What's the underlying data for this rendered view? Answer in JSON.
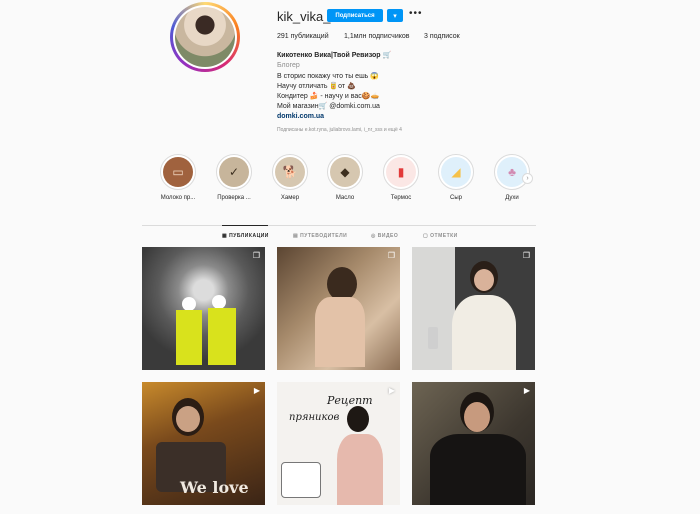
{
  "profile": {
    "username": "kik_vika_",
    "follow_label": "Подписаться",
    "dropdown_icon": "chevron-down-icon",
    "more_icon": "more-horizontal-icon",
    "stats": {
      "posts": "291 публикаций",
      "followers": "1,1млн подписчиков",
      "following": "3 подписок"
    },
    "bio": {
      "name": "Кикотенко Вика|Твой Ревизор 🛒",
      "category": "Блогер",
      "lines": [
        "В сторис покажу что ты ешь 😱",
        "Научу отличать 🥫от 💩",
        "Кондитер 🍰 - научу и вас🍪🥧",
        "Мой магазин🛒 @domki.com.ua"
      ],
      "link": "domki.com.ua",
      "followed_by": "Подписаны e.kot.ryna, juliabrovs.lami, i_nr_sss и ещё 4"
    }
  },
  "highlights": [
    {
      "label": "Молоко пр...",
      "icon": "milk-icon"
    },
    {
      "label": "Проверка ...",
      "icon": "check-icon"
    },
    {
      "label": "Хамер",
      "icon": "dog-icon"
    },
    {
      "label": "Масло",
      "icon": "butter-icon"
    },
    {
      "label": "Термос",
      "icon": "thermos-icon"
    },
    {
      "label": "Сыр",
      "icon": "cheese-icon"
    },
    {
      "label": "Духи",
      "icon": "perfume-icon"
    }
  ],
  "tabs": [
    {
      "label": "ПУБЛИКАЦИИ",
      "icon": "grid-icon",
      "active": true
    },
    {
      "label": "ПУТЕВОДИТЕЛИ",
      "icon": "guide-icon",
      "active": false
    },
    {
      "label": "ВИДЕО",
      "icon": "video-icon",
      "active": false
    },
    {
      "label": "ОТМЕТКИ",
      "icon": "tag-icon",
      "active": false
    }
  ],
  "posts": [
    {
      "caption": "",
      "type": "carousel"
    },
    {
      "caption": "",
      "type": "carousel"
    },
    {
      "caption": "",
      "type": "carousel"
    },
    {
      "caption": "We love",
      "type": "video"
    },
    {
      "caption_line1": "Рецепт",
      "caption_line2": "пряников",
      "type": "video"
    },
    {
      "caption": "",
      "type": "video"
    }
  ]
}
